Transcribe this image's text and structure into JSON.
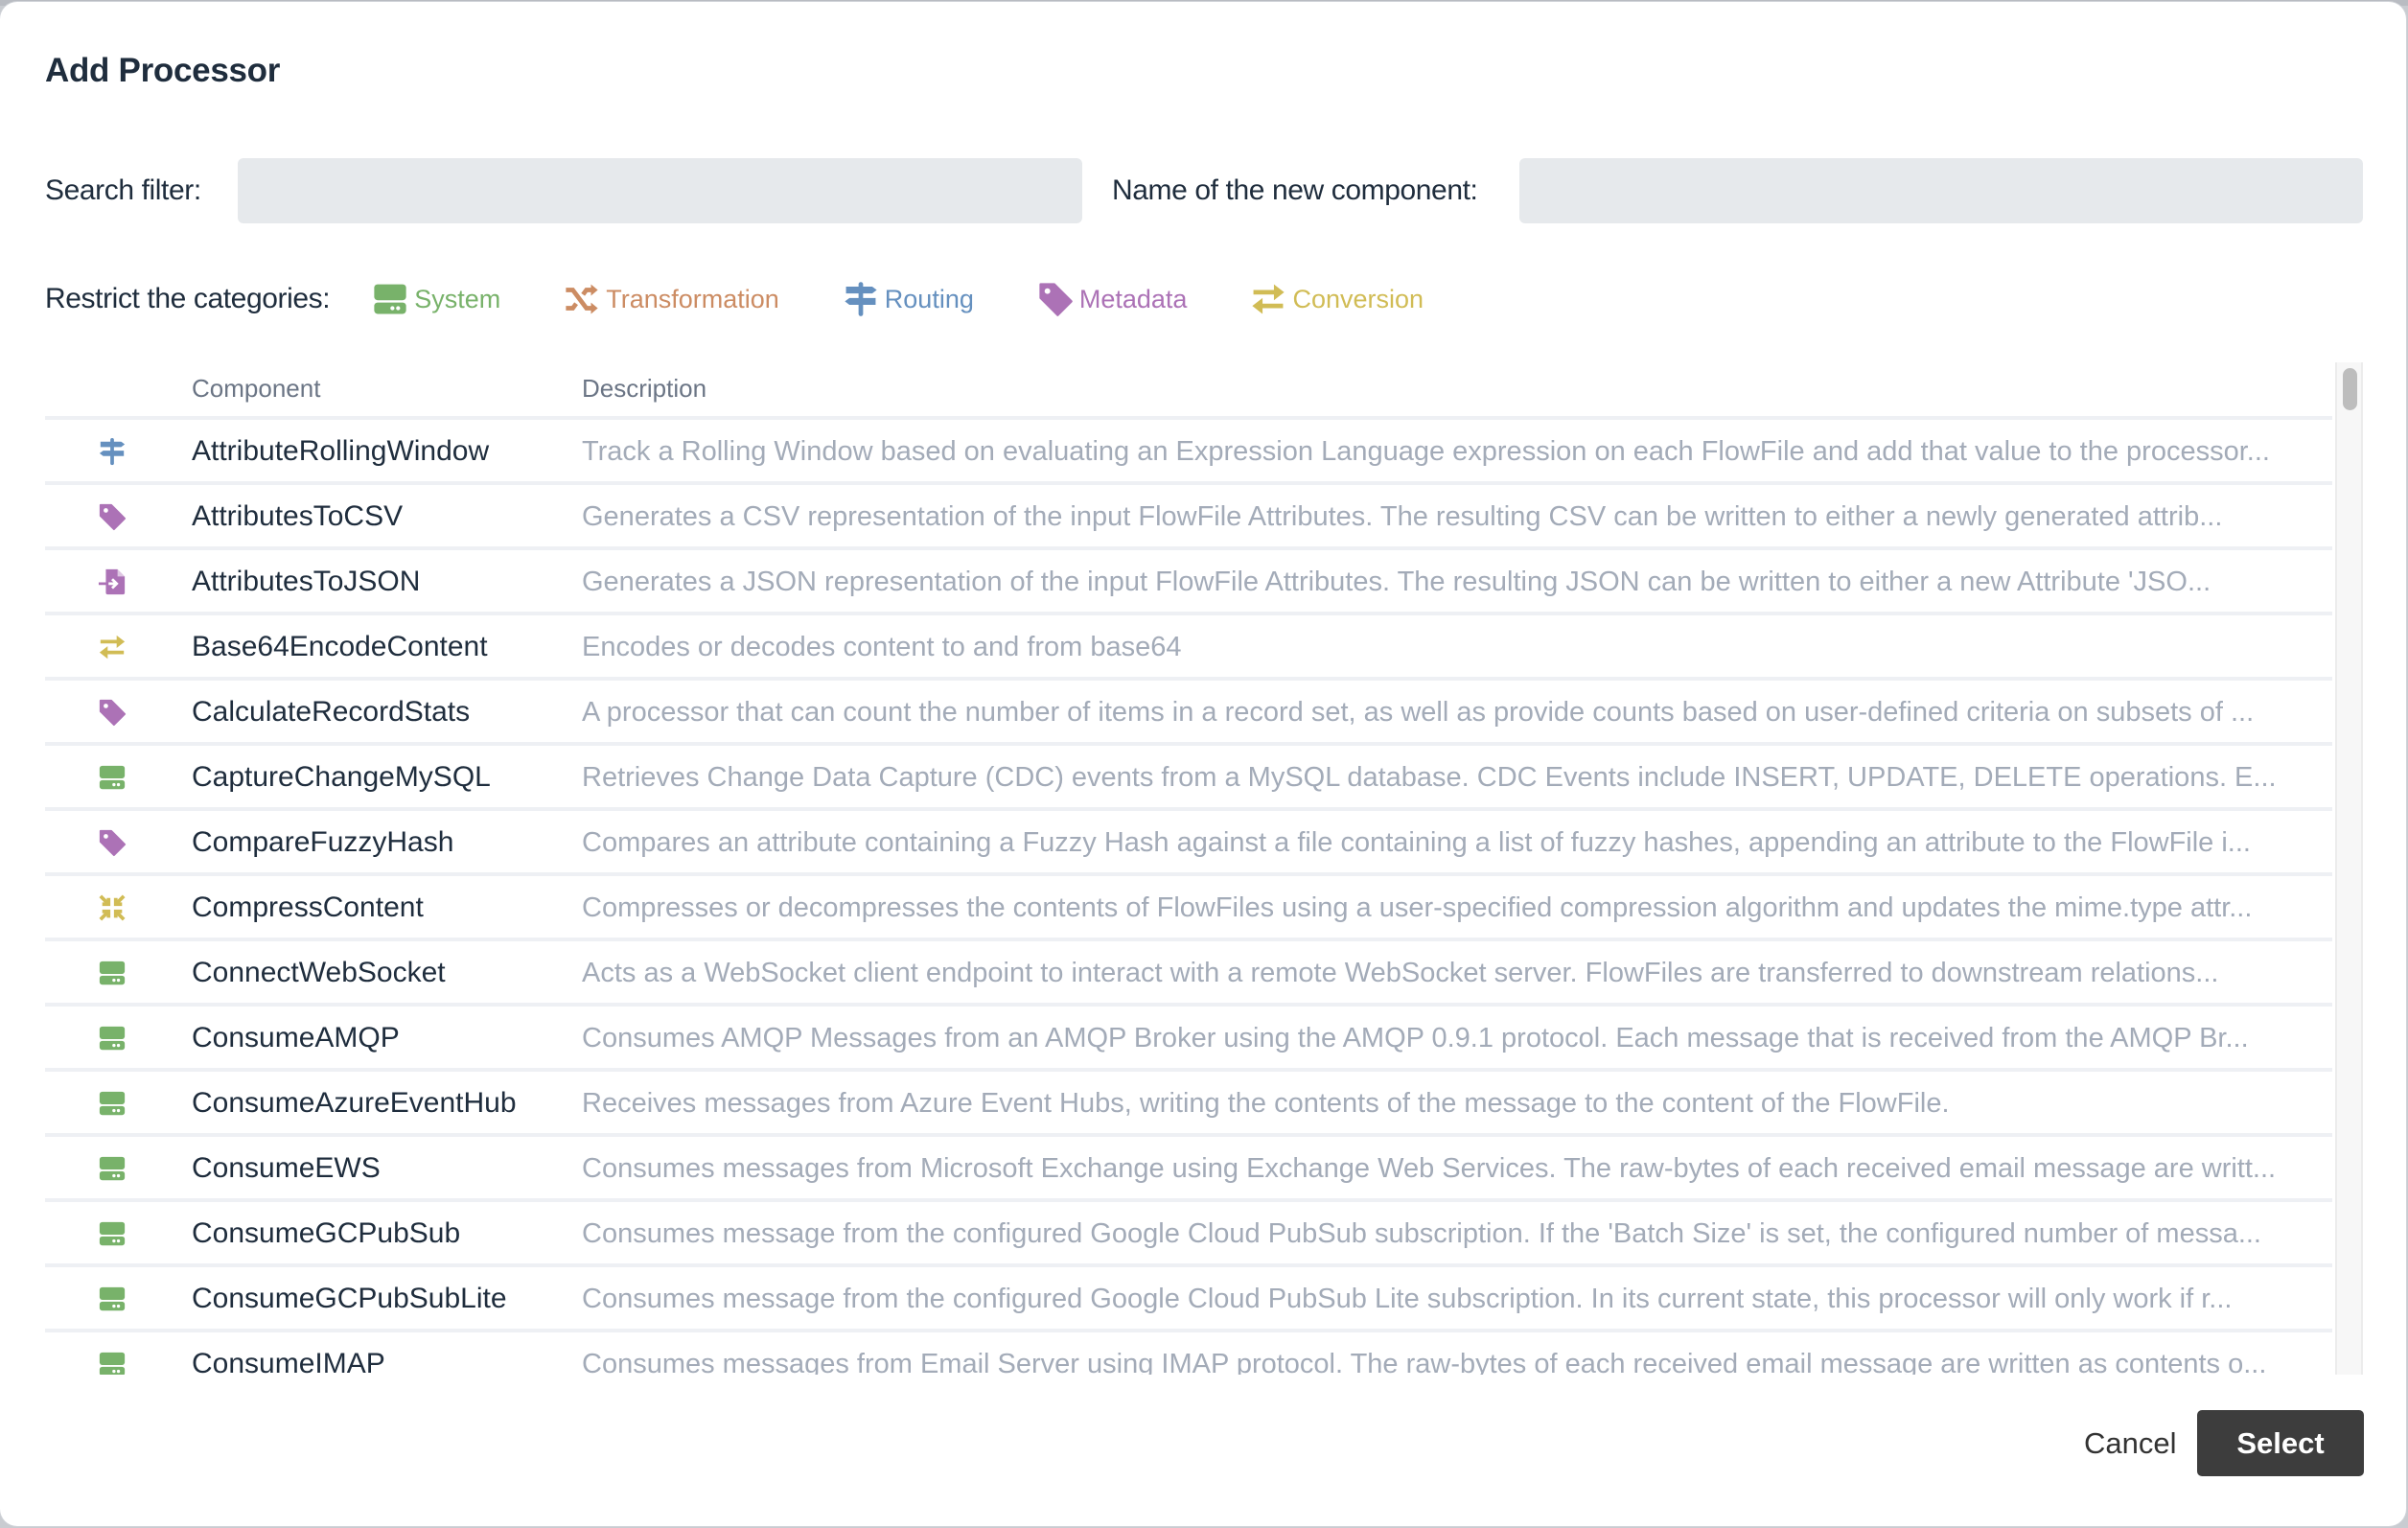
{
  "dialog": {
    "title": "Add Processor"
  },
  "search": {
    "label": "Search filter:",
    "value": "",
    "placeholder": ""
  },
  "name_field": {
    "label": "Name of the new component:",
    "value": "",
    "placeholder": ""
  },
  "categories": {
    "label": "Restrict the categories:",
    "items": [
      {
        "label": "System",
        "icon": "server-icon",
        "color": "#78b26a"
      },
      {
        "label": "Transformation",
        "icon": "shuffle-icon",
        "color": "#cc8c63"
      },
      {
        "label": "Routing",
        "icon": "signpost-icon",
        "color": "#6590bf"
      },
      {
        "label": "Metadata",
        "icon": "tag-icon",
        "color": "#ac72b6"
      },
      {
        "label": "Conversion",
        "icon": "exchange-icon",
        "color": "#d1bc55"
      }
    ]
  },
  "table": {
    "headers": {
      "component": "Component",
      "description": "Description"
    },
    "rows": [
      {
        "icon": "signpost-icon",
        "color": "#6590bf",
        "component": "AttributeRollingWindow",
        "description": "Track a Rolling Window based on evaluating an Expression Language expression on each FlowFile and add that value to the processor..."
      },
      {
        "icon": "tag-icon",
        "color": "#ac72b6",
        "component": "AttributesToCSV",
        "description": "Generates a CSV representation of the input FlowFile Attributes. The resulting CSV can be written to either a newly generated attrib..."
      },
      {
        "icon": "file-import-icon",
        "color": "#ac72b6",
        "component": "AttributesToJSON",
        "description": "Generates a JSON representation of the input FlowFile Attributes. The resulting JSON can be written to either a new Attribute 'JSO..."
      },
      {
        "icon": "exchange-icon",
        "color": "#d1bc55",
        "component": "Base64EncodeContent",
        "description": "Encodes or decodes content to and from base64"
      },
      {
        "icon": "tag-icon",
        "color": "#ac72b6",
        "component": "CalculateRecordStats",
        "description": "A processor that can count the number of items in a record set, as well as provide counts based on user-defined criteria on subsets of ..."
      },
      {
        "icon": "server-icon",
        "color": "#78b26a",
        "component": "CaptureChangeMySQL",
        "description": "Retrieves Change Data Capture (CDC) events from a MySQL database. CDC Events include INSERT, UPDATE, DELETE operations. E..."
      },
      {
        "icon": "tag-icon",
        "color": "#ac72b6",
        "component": "CompareFuzzyHash",
        "description": "Compares an attribute containing a Fuzzy Hash against a file containing a list of fuzzy hashes, appending an attribute to the FlowFile i..."
      },
      {
        "icon": "compress-icon",
        "color": "#d1bc55",
        "component": "CompressContent",
        "description": "Compresses or decompresses the contents of FlowFiles using a user-specified compression algorithm and updates the mime.type attr..."
      },
      {
        "icon": "server-icon",
        "color": "#78b26a",
        "component": "ConnectWebSocket",
        "description": "Acts as a WebSocket client endpoint to interact with a remote WebSocket server. FlowFiles are transferred to downstream relations..."
      },
      {
        "icon": "server-icon",
        "color": "#78b26a",
        "component": "ConsumeAMQP",
        "description": "Consumes AMQP Messages from an AMQP Broker using the AMQP 0.9.1 protocol. Each message that is received from the AMQP Br..."
      },
      {
        "icon": "server-icon",
        "color": "#78b26a",
        "component": "ConsumeAzureEventHub",
        "description": "Receives messages from Azure Event Hubs, writing the contents of the message to the content of the FlowFile."
      },
      {
        "icon": "server-icon",
        "color": "#78b26a",
        "component": "ConsumeEWS",
        "description": "Consumes messages from Microsoft Exchange using Exchange Web Services. The raw-bytes of each received email message are writt..."
      },
      {
        "icon": "server-icon",
        "color": "#78b26a",
        "component": "ConsumeGCPubSub",
        "description": "Consumes message from the configured Google Cloud PubSub subscription. If the 'Batch Size' is set, the configured number of messa..."
      },
      {
        "icon": "server-icon",
        "color": "#78b26a",
        "component": "ConsumeGCPubSubLite",
        "description": "Consumes message from the configured Google Cloud PubSub Lite subscription. In its current state, this processor will only work if r..."
      },
      {
        "icon": "server-icon",
        "color": "#78b26a",
        "component": "ConsumeIMAP",
        "description": "Consumes messages from Email Server using IMAP protocol. The raw-bytes of each received email message are written as contents o..."
      }
    ]
  },
  "footer": {
    "cancel_label": "Cancel",
    "select_label": "Select"
  }
}
